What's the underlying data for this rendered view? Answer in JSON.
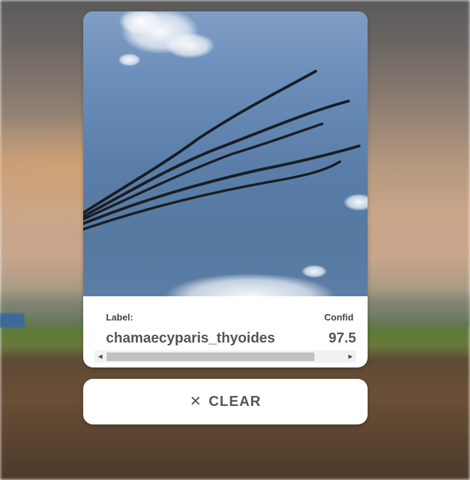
{
  "result": {
    "label_header": "Label:",
    "label_value": "chamaecyparis_thyoides",
    "confidence_header": "Confid",
    "confidence_value": "97.5"
  },
  "image": {
    "subject": "evergreen needle sprigs against blue sky with clouds"
  },
  "clear_button": {
    "icon": "close-icon",
    "label": "CLEAR"
  },
  "colors": {
    "card": "#ffffff",
    "text": "#555555",
    "scrollbar_thumb": "#c1c1c1"
  }
}
